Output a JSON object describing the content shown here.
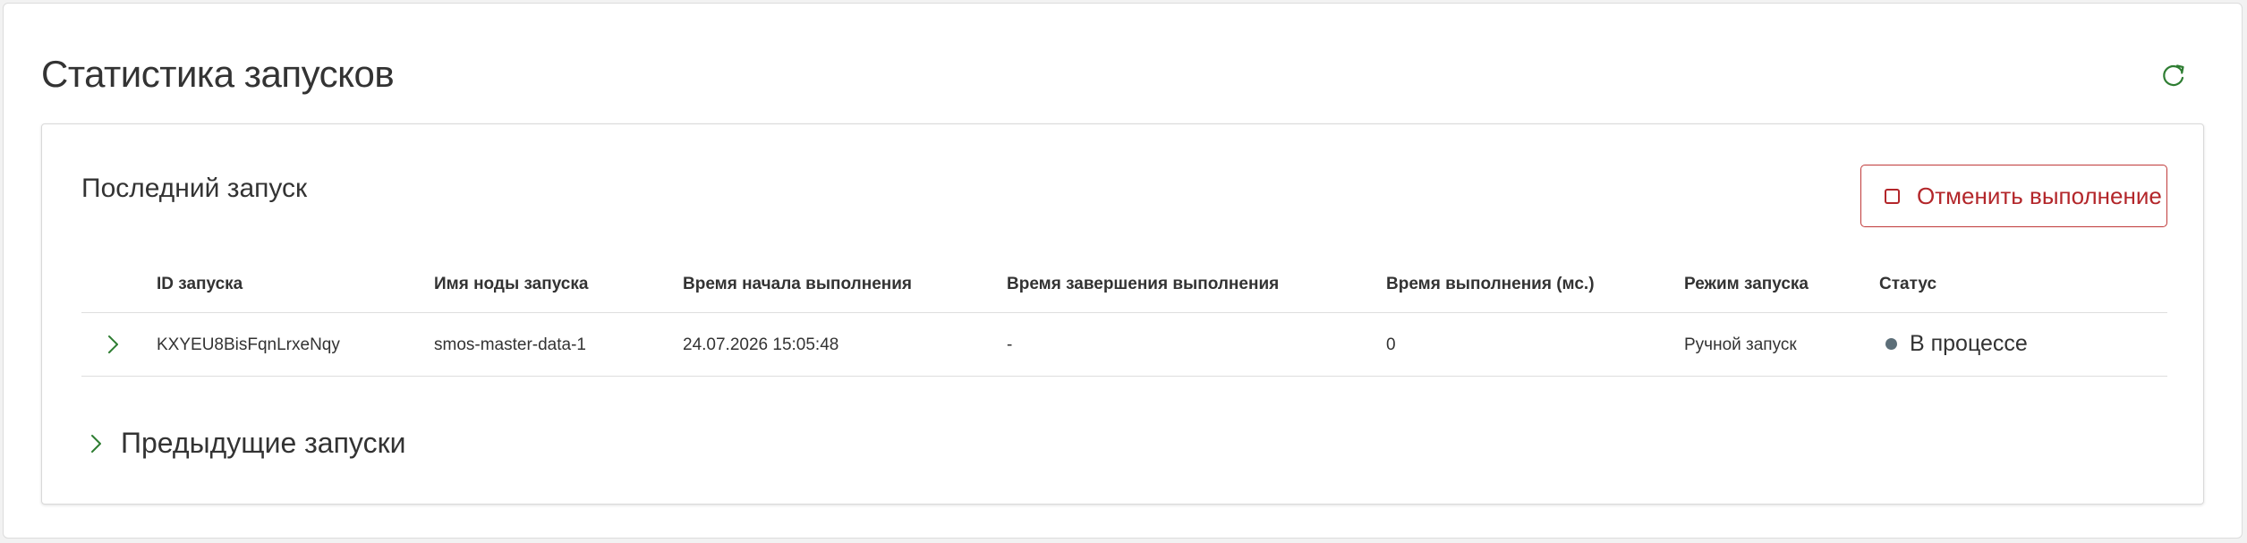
{
  "page": {
    "title": "Статистика запусков",
    "refresh_icon": "refresh-icon",
    "accent_color": "#2e7d32"
  },
  "last_run": {
    "title": "Последний запуск",
    "cancel_label": "Отменить выполнение",
    "cancel_icon": "stop-square-icon",
    "cancel_color": "#b3262a",
    "columns": [
      "ID запуска",
      "Имя ноды запуска",
      "Время начала выполнения",
      "Время завершения выполнения",
      "Время выполнения (мс.)",
      "Режим запуска",
      "Статус"
    ],
    "rows": [
      {
        "id": "KXYEU8BisFqnLrxeNqy",
        "node": "smos-master-data-1",
        "start": "24.07.2026 15:05:48",
        "end": "-",
        "duration": "0",
        "mode": "Ручной запуск",
        "status": "В процессе",
        "status_color": "#5c6e78"
      }
    ]
  },
  "previous_runs": {
    "title": "Предыдущие запуски",
    "expanded": false
  }
}
